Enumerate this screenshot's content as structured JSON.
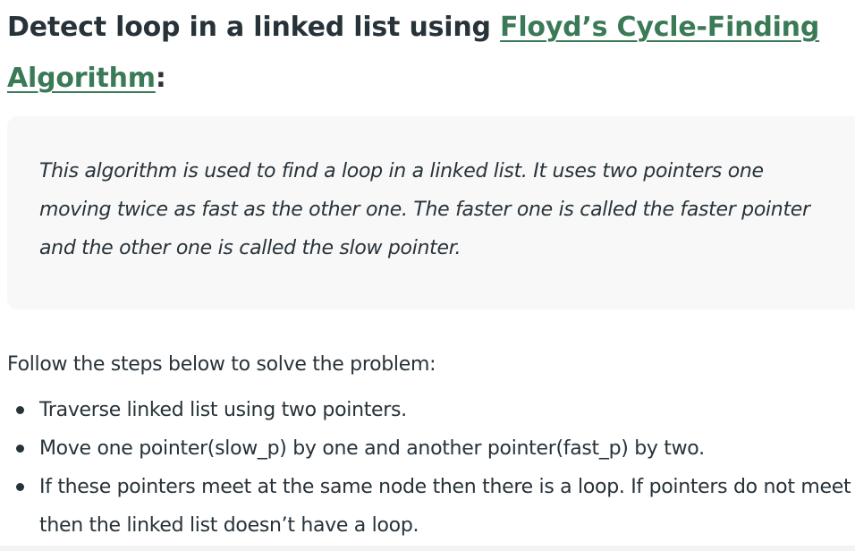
{
  "heading": {
    "prefix": "Detect loop in a linked list using ",
    "link_text": "Floyd’s Cycle-Finding Algorithm",
    "suffix": ":"
  },
  "blockquote": {
    "text": "This algorithm is used to find a loop in a linked list. It uses two pointers one moving twice as fast as the other one. The faster one is called the faster pointer and the other one is called the slow pointer."
  },
  "intro": "Follow the steps below to solve the problem:",
  "steps": [
    "Traverse linked list using two pointers.",
    "Move one pointer(slow_p) by one and another pointer(fast_p) by two.",
    "If these pointers meet at the same node then there is a loop. If pointers do not meet then the linked list doesn’t have a loop."
  ],
  "colors": {
    "heading": "#273239",
    "link": "#3b7a57",
    "blockquote_bg": "#f8f8f8",
    "text": "#273239"
  }
}
